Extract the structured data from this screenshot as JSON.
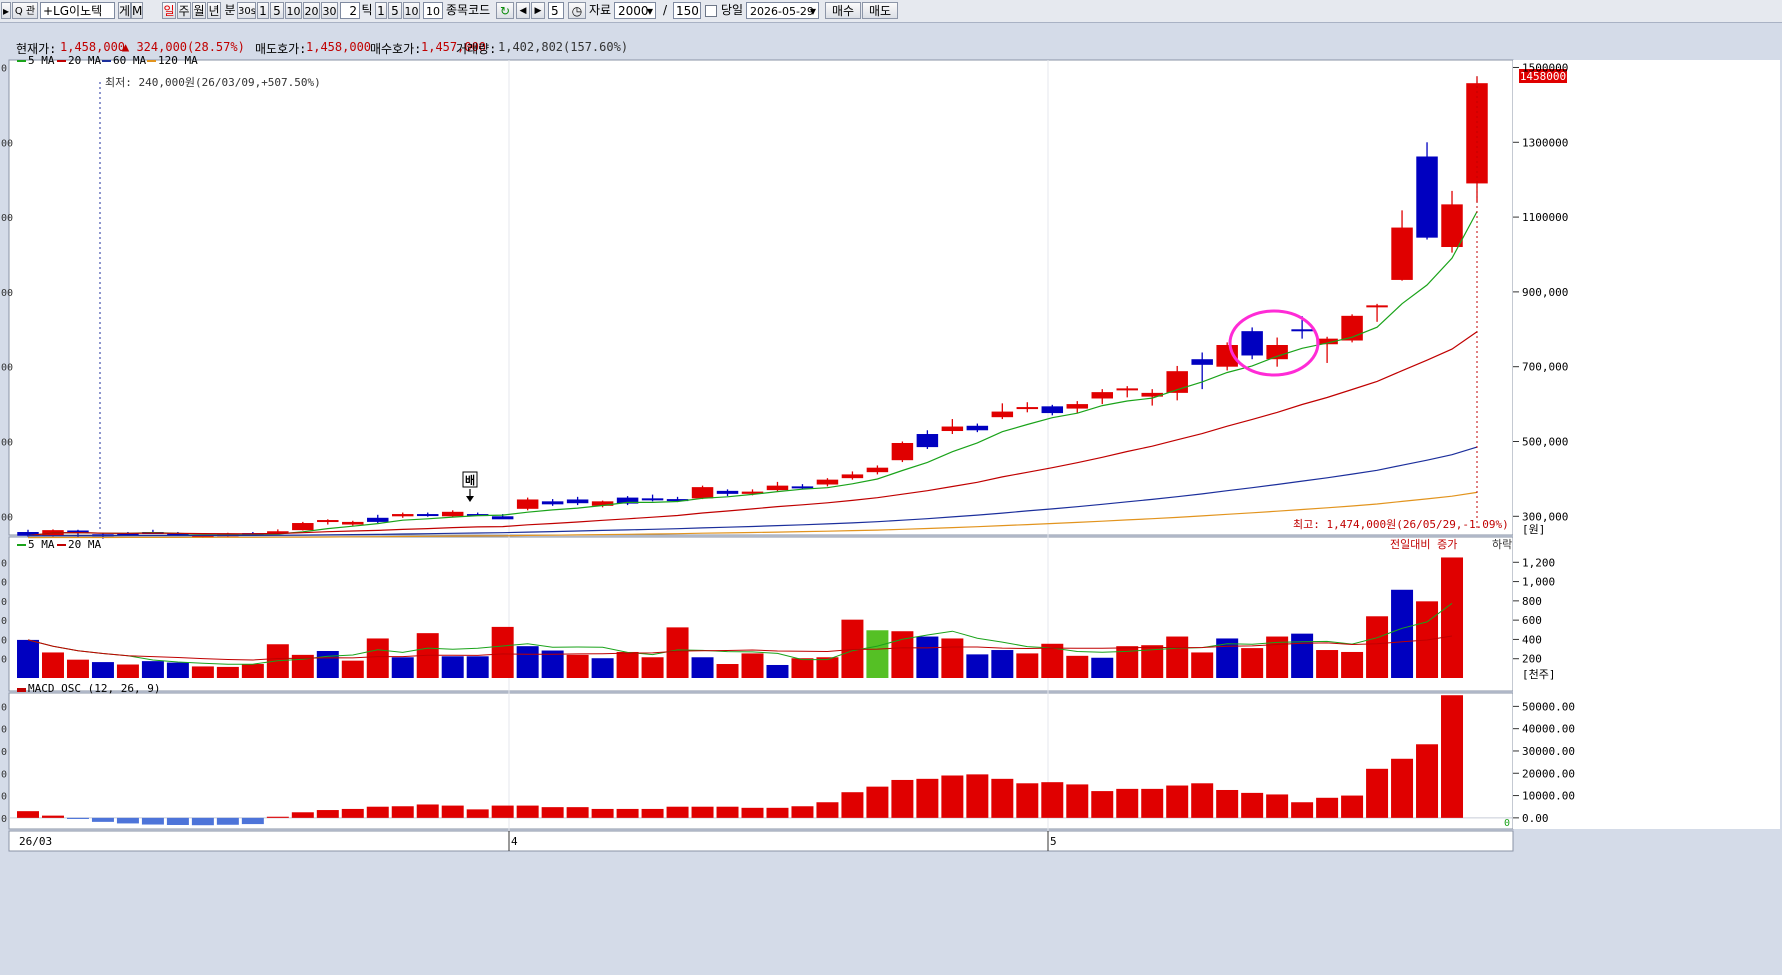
{
  "toolbar": {
    "search_label": "Q 관",
    "stock_name": "+LG이노텍",
    "btn_ge": "게",
    "btn_m": "M",
    "periods": [
      "일",
      "주",
      "월",
      "년",
      "분"
    ],
    "minutes": [
      "30s",
      "1",
      "5",
      "10",
      "20",
      "30"
    ],
    "tick_value": "2",
    "tick_label": "틱",
    "ticks": [
      "1",
      "5",
      "10"
    ],
    "tick_count": "10",
    "stock_code_label": "종목코드",
    "nav_count": "5",
    "data_label": "자료",
    "data_count": "2000",
    "slash": "/",
    "view_count": "150",
    "same_day_label": "당일",
    "date": "2026-05-29",
    "buy": "매수",
    "sell": "매도"
  },
  "info": {
    "current_label": "현재가:",
    "current_value": "1,458,000",
    "change": "▲ 324,000(28.57%)",
    "ask_label": "매도호가:",
    "ask_value": "1,458,000",
    "bid_label": "매수호가:",
    "bid_value": "1,457,000",
    "volume_label": "거래량:",
    "volume_value": "1,402,802(157.60%)"
  },
  "colors": {
    "up": "#e00000",
    "down": "#0000c0",
    "flat": "#55c025",
    "ma5": "#1aa31a",
    "ma20": "#c00000",
    "ma60": "#1c2f9c",
    "ma120": "#e2941e",
    "macd_neg": "#4d74d9",
    "highlight": "#ff2bd6",
    "price_tag_bg": "#e00000"
  },
  "price_panel": {
    "legend": [
      "5 MA",
      "20 MA",
      "60 MA",
      "120 MA"
    ],
    "low_note": "최저: 240,000원(26/03/09,+507.50%)",
    "high_note": "최고: 1,474,000원(26/05/29,-1.09%)",
    "marker_label": "배",
    "unit": "[원]",
    "current_tag": "1458000",
    "axis_labels": [
      "1500000",
      "1300000",
      "1100000",
      "900,000",
      "700,000",
      "500,000",
      "300,000"
    ],
    "left_ticks": [
      "0",
      "00",
      "00",
      "00",
      "00",
      "00",
      "00"
    ]
  },
  "volume_panel": {
    "legend": [
      "5 MA",
      "20 MA"
    ],
    "note": "전일대비 증가",
    "note_tail": "하락",
    "unit": "[천주]",
    "axis_labels": [
      "1,200",
      "1,000",
      "800",
      "600",
      "400",
      "200"
    ],
    "left_ticks": [
      "0",
      "0",
      "0",
      "0",
      "0",
      "0"
    ]
  },
  "macd_panel": {
    "legend": "MACD OSC (12, 26, 9)",
    "axis_labels": [
      "50000.00",
      "40000.00",
      "30000.00",
      "20000.00",
      "10000.00",
      "0.00"
    ],
    "left_ticks": [
      "0",
      "0",
      "0",
      "0",
      "0",
      "0"
    ],
    "zero_label": "0"
  },
  "date_axis": {
    "labels": [
      "26/03",
      "4",
      "5"
    ]
  },
  "chart_data": {
    "type": "candlestick",
    "x_start": "2026-03-03",
    "x_end": "2026-05-29",
    "ylim": [
      250000,
      1520000
    ],
    "candles": [
      {
        "o": 258000,
        "h": 264000,
        "l": 246000,
        "c": 248000
      },
      {
        "o": 248000,
        "h": 265000,
        "l": 246000,
        "c": 263000
      },
      {
        "o": 262000,
        "h": 264000,
        "l": 245000,
        "c": 258000
      },
      {
        "o": 252000,
        "h": 256000,
        "l": 240000,
        "c": 250000
      },
      {
        "o": 255000,
        "h": 258000,
        "l": 250000,
        "c": 254000
      },
      {
        "o": 258000,
        "h": 264000,
        "l": 254000,
        "c": 257000
      },
      {
        "o": 254000,
        "h": 258000,
        "l": 250000,
        "c": 252000
      },
      {
        "o": 244000,
        "h": 250000,
        "l": 242000,
        "c": 248000
      },
      {
        "o": 248000,
        "h": 256000,
        "l": 246000,
        "c": 252000
      },
      {
        "o": 255000,
        "h": 258000,
        "l": 250000,
        "c": 251000
      },
      {
        "o": 256000,
        "h": 265000,
        "l": 254000,
        "c": 260000
      },
      {
        "o": 263000,
        "h": 285000,
        "l": 262000,
        "c": 282000
      },
      {
        "o": 286000,
        "h": 292000,
        "l": 278000,
        "c": 290000
      },
      {
        "o": 278000,
        "h": 288000,
        "l": 275000,
        "c": 285000
      },
      {
        "o": 296000,
        "h": 304000,
        "l": 282000,
        "c": 285000
      },
      {
        "o": 300000,
        "h": 310000,
        "l": 296000,
        "c": 306000
      },
      {
        "o": 306000,
        "h": 310000,
        "l": 299000,
        "c": 301000
      },
      {
        "o": 300000,
        "h": 316000,
        "l": 297000,
        "c": 312000
      },
      {
        "o": 306000,
        "h": 310000,
        "l": 302000,
        "c": 305000
      },
      {
        "o": 300000,
        "h": 306000,
        "l": 298000,
        "c": 292000
      },
      {
        "o": 320000,
        "h": 350000,
        "l": 316000,
        "c": 345000
      },
      {
        "o": 340000,
        "h": 346000,
        "l": 328000,
        "c": 332000
      },
      {
        "o": 345000,
        "h": 352000,
        "l": 330000,
        "c": 335000
      },
      {
        "o": 328000,
        "h": 342000,
        "l": 324000,
        "c": 340000
      },
      {
        "o": 350000,
        "h": 354000,
        "l": 330000,
        "c": 334000
      },
      {
        "o": 348000,
        "h": 358000,
        "l": 340000,
        "c": 345000
      },
      {
        "o": 346000,
        "h": 352000,
        "l": 338000,
        "c": 344000
      },
      {
        "o": 348000,
        "h": 382000,
        "l": 346000,
        "c": 378000
      },
      {
        "o": 368000,
        "h": 372000,
        "l": 354000,
        "c": 360000
      },
      {
        "o": 360000,
        "h": 372000,
        "l": 356000,
        "c": 366000
      },
      {
        "o": 370000,
        "h": 392000,
        "l": 366000,
        "c": 382000
      },
      {
        "o": 380000,
        "h": 386000,
        "l": 372000,
        "c": 376000
      },
      {
        "o": 385000,
        "h": 402000,
        "l": 380000,
        "c": 398000
      },
      {
        "o": 402000,
        "h": 420000,
        "l": 398000,
        "c": 412000
      },
      {
        "o": 418000,
        "h": 436000,
        "l": 412000,
        "c": 430000
      },
      {
        "o": 450000,
        "h": 500000,
        "l": 445000,
        "c": 496000
      },
      {
        "o": 520000,
        "h": 530000,
        "l": 480000,
        "c": 485000
      },
      {
        "o": 528000,
        "h": 560000,
        "l": 520000,
        "c": 540000
      },
      {
        "o": 542000,
        "h": 548000,
        "l": 525000,
        "c": 530000
      },
      {
        "o": 565000,
        "h": 602000,
        "l": 560000,
        "c": 580000
      },
      {
        "o": 590000,
        "h": 605000,
        "l": 578000,
        "c": 592000
      },
      {
        "o": 594000,
        "h": 598000,
        "l": 570000,
        "c": 576000
      },
      {
        "o": 588000,
        "h": 608000,
        "l": 576000,
        "c": 600000
      },
      {
        "o": 615000,
        "h": 640000,
        "l": 600000,
        "c": 632000
      },
      {
        "o": 640000,
        "h": 648000,
        "l": 618000,
        "c": 642000
      },
      {
        "o": 620000,
        "h": 640000,
        "l": 596000,
        "c": 630000
      },
      {
        "o": 630000,
        "h": 702000,
        "l": 610000,
        "c": 688000
      },
      {
        "o": 720000,
        "h": 738000,
        "l": 640000,
        "c": 705000
      },
      {
        "o": 700000,
        "h": 765000,
        "l": 690000,
        "c": 758000
      },
      {
        "o": 795000,
        "h": 805000,
        "l": 720000,
        "c": 730000
      },
      {
        "o": 720000,
        "h": 778000,
        "l": 700000,
        "c": 758000
      },
      {
        "o": 800000,
        "h": 835000,
        "l": 775000,
        "c": 795000
      },
      {
        "o": 760000,
        "h": 780000,
        "l": 710000,
        "c": 775000
      },
      {
        "o": 770000,
        "h": 840000,
        "l": 765000,
        "c": 836000
      },
      {
        "o": 860000,
        "h": 868000,
        "l": 820000,
        "c": 864000
      },
      {
        "o": 932000,
        "h": 1118000,
        "l": 930000,
        "c": 1072000
      },
      {
        "o": 1262000,
        "h": 1300000,
        "l": 1040000,
        "c": 1045000
      },
      {
        "o": 1020000,
        "h": 1170000,
        "l": 1005000,
        "c": 1134000
      },
      {
        "o": 1190000,
        "h": 1474000,
        "l": 1140000,
        "c": 1458000
      }
    ],
    "volume_k": [
      395,
      265,
      190,
      165,
      140,
      175,
      160,
      120,
      115,
      145,
      350,
      240,
      280,
      180,
      410,
      215,
      465,
      225,
      225,
      530,
      330,
      285,
      240,
      205,
      270,
      215,
      525,
      215,
      145,
      255,
      135,
      205,
      215,
      605,
      495,
      485,
      430,
      410,
      245,
      290,
      255,
      355,
      230,
      210,
      330,
      340,
      430,
      265,
      410,
      310,
      430,
      460,
      290,
      270,
      640,
      915,
      795,
      1250
    ],
    "volume_colors": [
      "down",
      "up",
      "up",
      "down",
      "up",
      "down",
      "down",
      "up",
      "up",
      "up",
      "up",
      "up",
      "down",
      "up",
      "up",
      "down",
      "up",
      "down",
      "down",
      "up",
      "down",
      "down",
      "up",
      "down",
      "up",
      "up",
      "up",
      "down",
      "up",
      "up",
      "down",
      "up",
      "up",
      "up",
      "flat",
      "up",
      "down",
      "up",
      "down",
      "down",
      "up",
      "up",
      "up",
      "down",
      "up",
      "up",
      "up",
      "up",
      "down",
      "up",
      "up",
      "down",
      "up",
      "up",
      "up",
      "down",
      "up",
      "up"
    ],
    "macd": [
      3000,
      1000,
      -500,
      -1800,
      -2500,
      -3000,
      -3200,
      -3300,
      -3100,
      -2800,
      500,
      2500,
      3500,
      4000,
      5000,
      5200,
      6000,
      5500,
      3800,
      5500,
      5500,
      4800,
      4800,
      4000,
      4000,
      4000,
      5000,
      5000,
      5000,
      4500,
      4500,
      5200,
      7000,
      11500,
      14000,
      17000,
      17500,
      19000,
      19500,
      17500,
      15500,
      16000,
      15000,
      12000,
      13000,
      13000,
      14500,
      15500,
      12500,
      11200,
      10500,
      7000,
      9000,
      10000,
      22000,
      26500,
      33000,
      55000
    ],
    "vol_ylim": [
      0,
      1400
    ],
    "macd_ylim": [
      -5000,
      56000
    ]
  }
}
